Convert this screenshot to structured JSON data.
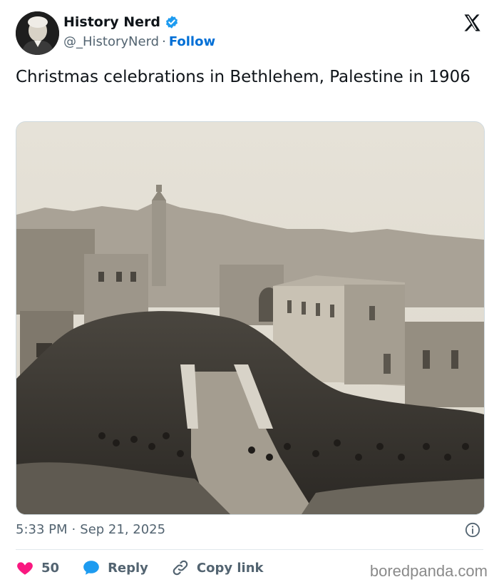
{
  "author": {
    "name": "History Nerd",
    "handle": "@_HistoryNerd",
    "separator": "·",
    "follow_label": "Follow"
  },
  "tweet": {
    "text": "Christmas celebrations in Bethlehem, Palestine in 1906",
    "time": "5:33 PM",
    "date": "Sep 21, 2025"
  },
  "actions": {
    "like_count": "50",
    "reply_label": "Reply",
    "copy_link_label": "Copy link"
  },
  "watermark": "boredpanda.com",
  "colors": {
    "accent": "#1d9bf0",
    "like": "#f91880",
    "text_secondary": "#536471"
  },
  "icons": {
    "verified": "verified-badge-icon",
    "x_logo": "x-logo-icon",
    "info": "info-icon",
    "like": "heart-icon",
    "reply": "speech-bubble-icon",
    "copy_link": "link-icon"
  }
}
